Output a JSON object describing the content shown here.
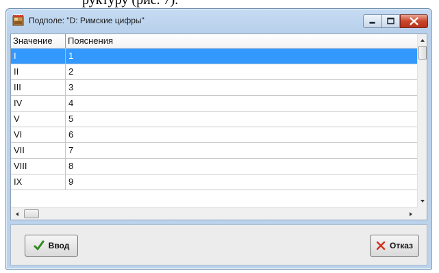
{
  "background_fragment": "руктуру (рис. 7).",
  "window": {
    "title": "Подполе: \"D: Римские цифры\""
  },
  "grid": {
    "columns": [
      "Значение",
      "Пояснения"
    ],
    "rows": [
      {
        "value": "I",
        "note": "1",
        "selected": true
      },
      {
        "value": "II",
        "note": "2"
      },
      {
        "value": "III",
        "note": "3"
      },
      {
        "value": "IV",
        "note": "4"
      },
      {
        "value": "V",
        "note": "5"
      },
      {
        "value": "VI",
        "note": "6"
      },
      {
        "value": "VII",
        "note": "7"
      },
      {
        "value": "VIII",
        "note": "8"
      },
      {
        "value": "IX",
        "note": "9"
      }
    ]
  },
  "buttons": {
    "ok_label": "Ввод",
    "cancel_label": "Отказ"
  },
  "icons": {
    "app": "app-icon",
    "minimize": "minimize-icon",
    "maximize": "maximize-icon",
    "close": "close-icon",
    "ok": "checkmark-icon",
    "cancel": "x-mark-icon"
  },
  "colors": {
    "selection": "#3399ff",
    "close_button": "#c9462c",
    "checkmark": "#2f8a1e",
    "cancel_x": "#d6301c"
  }
}
